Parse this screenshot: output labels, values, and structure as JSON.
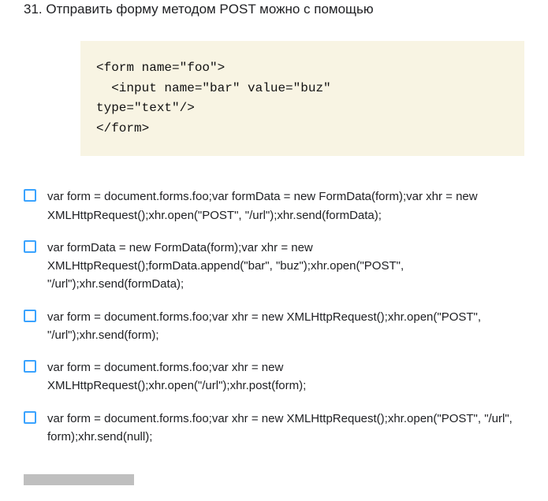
{
  "question": {
    "number": "31",
    "text": "Отправить форму методом POST можно с помощью"
  },
  "code_lines": [
    "<form name=\"foo\">",
    "  <input name=\"bar\" value=\"buz\"",
    "type=\"text\"/>",
    "</form>"
  ],
  "options": [
    "var form = document.forms.foo;var formData = new FormData(form);var xhr = new XMLHttpRequest();xhr.open(\"POST\", \"/url\");xhr.send(formData);",
    "var formData = new FormData(form);var xhr = new XMLHttpRequest();formData.append(\"bar\", \"buz\");xhr.open(\"POST\", \"/url\");xhr.send(formData);",
    "var form = document.forms.foo;var xhr = new XMLHttpRequest();xhr.open(\"POST\", \"/url\");xhr.send(form);",
    "var form = document.forms.foo;var xhr = new XMLHttpRequest();xhr.open(\"/url\");xhr.post(form);",
    "var form = document.forms.foo;var xhr = new XMLHttpRequest();xhr.open(\"POST\", \"/url\", form);xhr.send(null);"
  ]
}
